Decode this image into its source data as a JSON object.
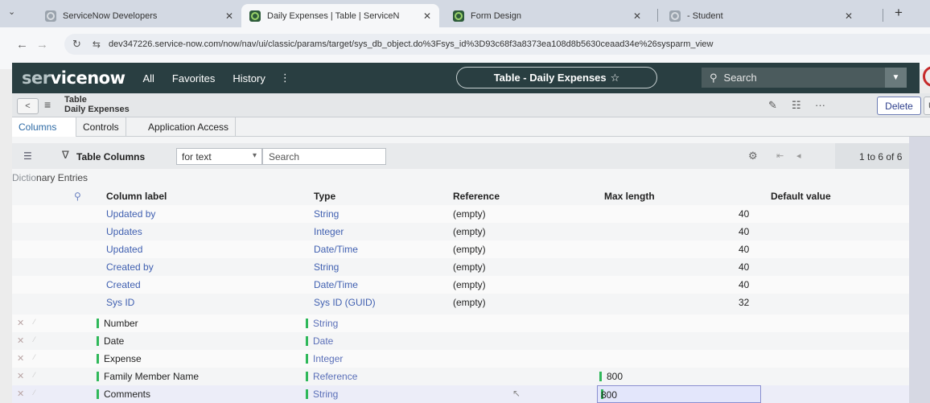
{
  "browser": {
    "tabs": [
      {
        "title": "ServiceNow Developers"
      },
      {
        "title": "Daily Expenses | Table | ServiceN"
      },
      {
        "title": "Form Design"
      },
      {
        "title": "- Student"
      }
    ],
    "url": "dev347226.service-now.com/now/nav/ui/classic/params/target/sys_db_object.do%3Fsys_id%3D93c68f3a8373ea108d8b5630ceaad34e%26sysparm_view"
  },
  "header": {
    "logo_dark": "ser",
    "logo_light": "vicenow",
    "menu": [
      "All",
      "Favorites",
      "History"
    ],
    "context_pill": "Table - Daily Expenses",
    "search_placeholder": "Search"
  },
  "form": {
    "record_type": "Table",
    "record_name": "Daily Expenses",
    "delete_label": "Delete",
    "update_label": "U",
    "tabs": [
      "Columns",
      "Controls",
      "Application Access"
    ]
  },
  "list": {
    "title": "Table Columns",
    "search_field": "for text",
    "search_placeholder": "Search",
    "count": "1 to 6 of 6",
    "section_faded": "Dictio",
    "section_rest": "nary Entries",
    "columns": [
      "Column label",
      "Type",
      "Reference",
      "Max length",
      "Default value"
    ],
    "rows": [
      {
        "label": "Updated by",
        "type": "String",
        "reference": "(empty)",
        "max_length": "40"
      },
      {
        "label": "Updates",
        "type": "Integer",
        "reference": "(empty)",
        "max_length": "40"
      },
      {
        "label": "Updated",
        "type": "Date/Time",
        "reference": "(empty)",
        "max_length": "40"
      },
      {
        "label": "Created by",
        "type": "String",
        "reference": "(empty)",
        "max_length": "40"
      },
      {
        "label": "Created",
        "type": "Date/Time",
        "reference": "(empty)",
        "max_length": "40"
      },
      {
        "label": "Sys ID",
        "type": "Sys ID (GUID)",
        "reference": "(empty)",
        "max_length": "32"
      }
    ],
    "new_rows": [
      {
        "label": "Number",
        "type": "String",
        "max_length": ""
      },
      {
        "label": "Date",
        "type": "Date",
        "max_length": ""
      },
      {
        "label": "Expense",
        "type": "Integer",
        "max_length": ""
      },
      {
        "label": "Family Member Name",
        "type": "Reference",
        "max_length": "800"
      },
      {
        "label": "Comments",
        "type": "String",
        "max_length": "800"
      }
    ]
  },
  "colors": {
    "header_bg": "#293e41",
    "link": "#3f5fb0",
    "new_row_bar": "#2fb85a",
    "edit_cell": "#e3e6fb"
  },
  "icons": [
    "chevron-down-icon",
    "close-icon",
    "back-icon",
    "reload-icon",
    "tune-icon",
    "star-icon",
    "search-icon",
    "filter-icon",
    "gear-icon",
    "paperclip-icon",
    "settings-sliders-icon",
    "more-icon",
    "hamburger-icon"
  ]
}
